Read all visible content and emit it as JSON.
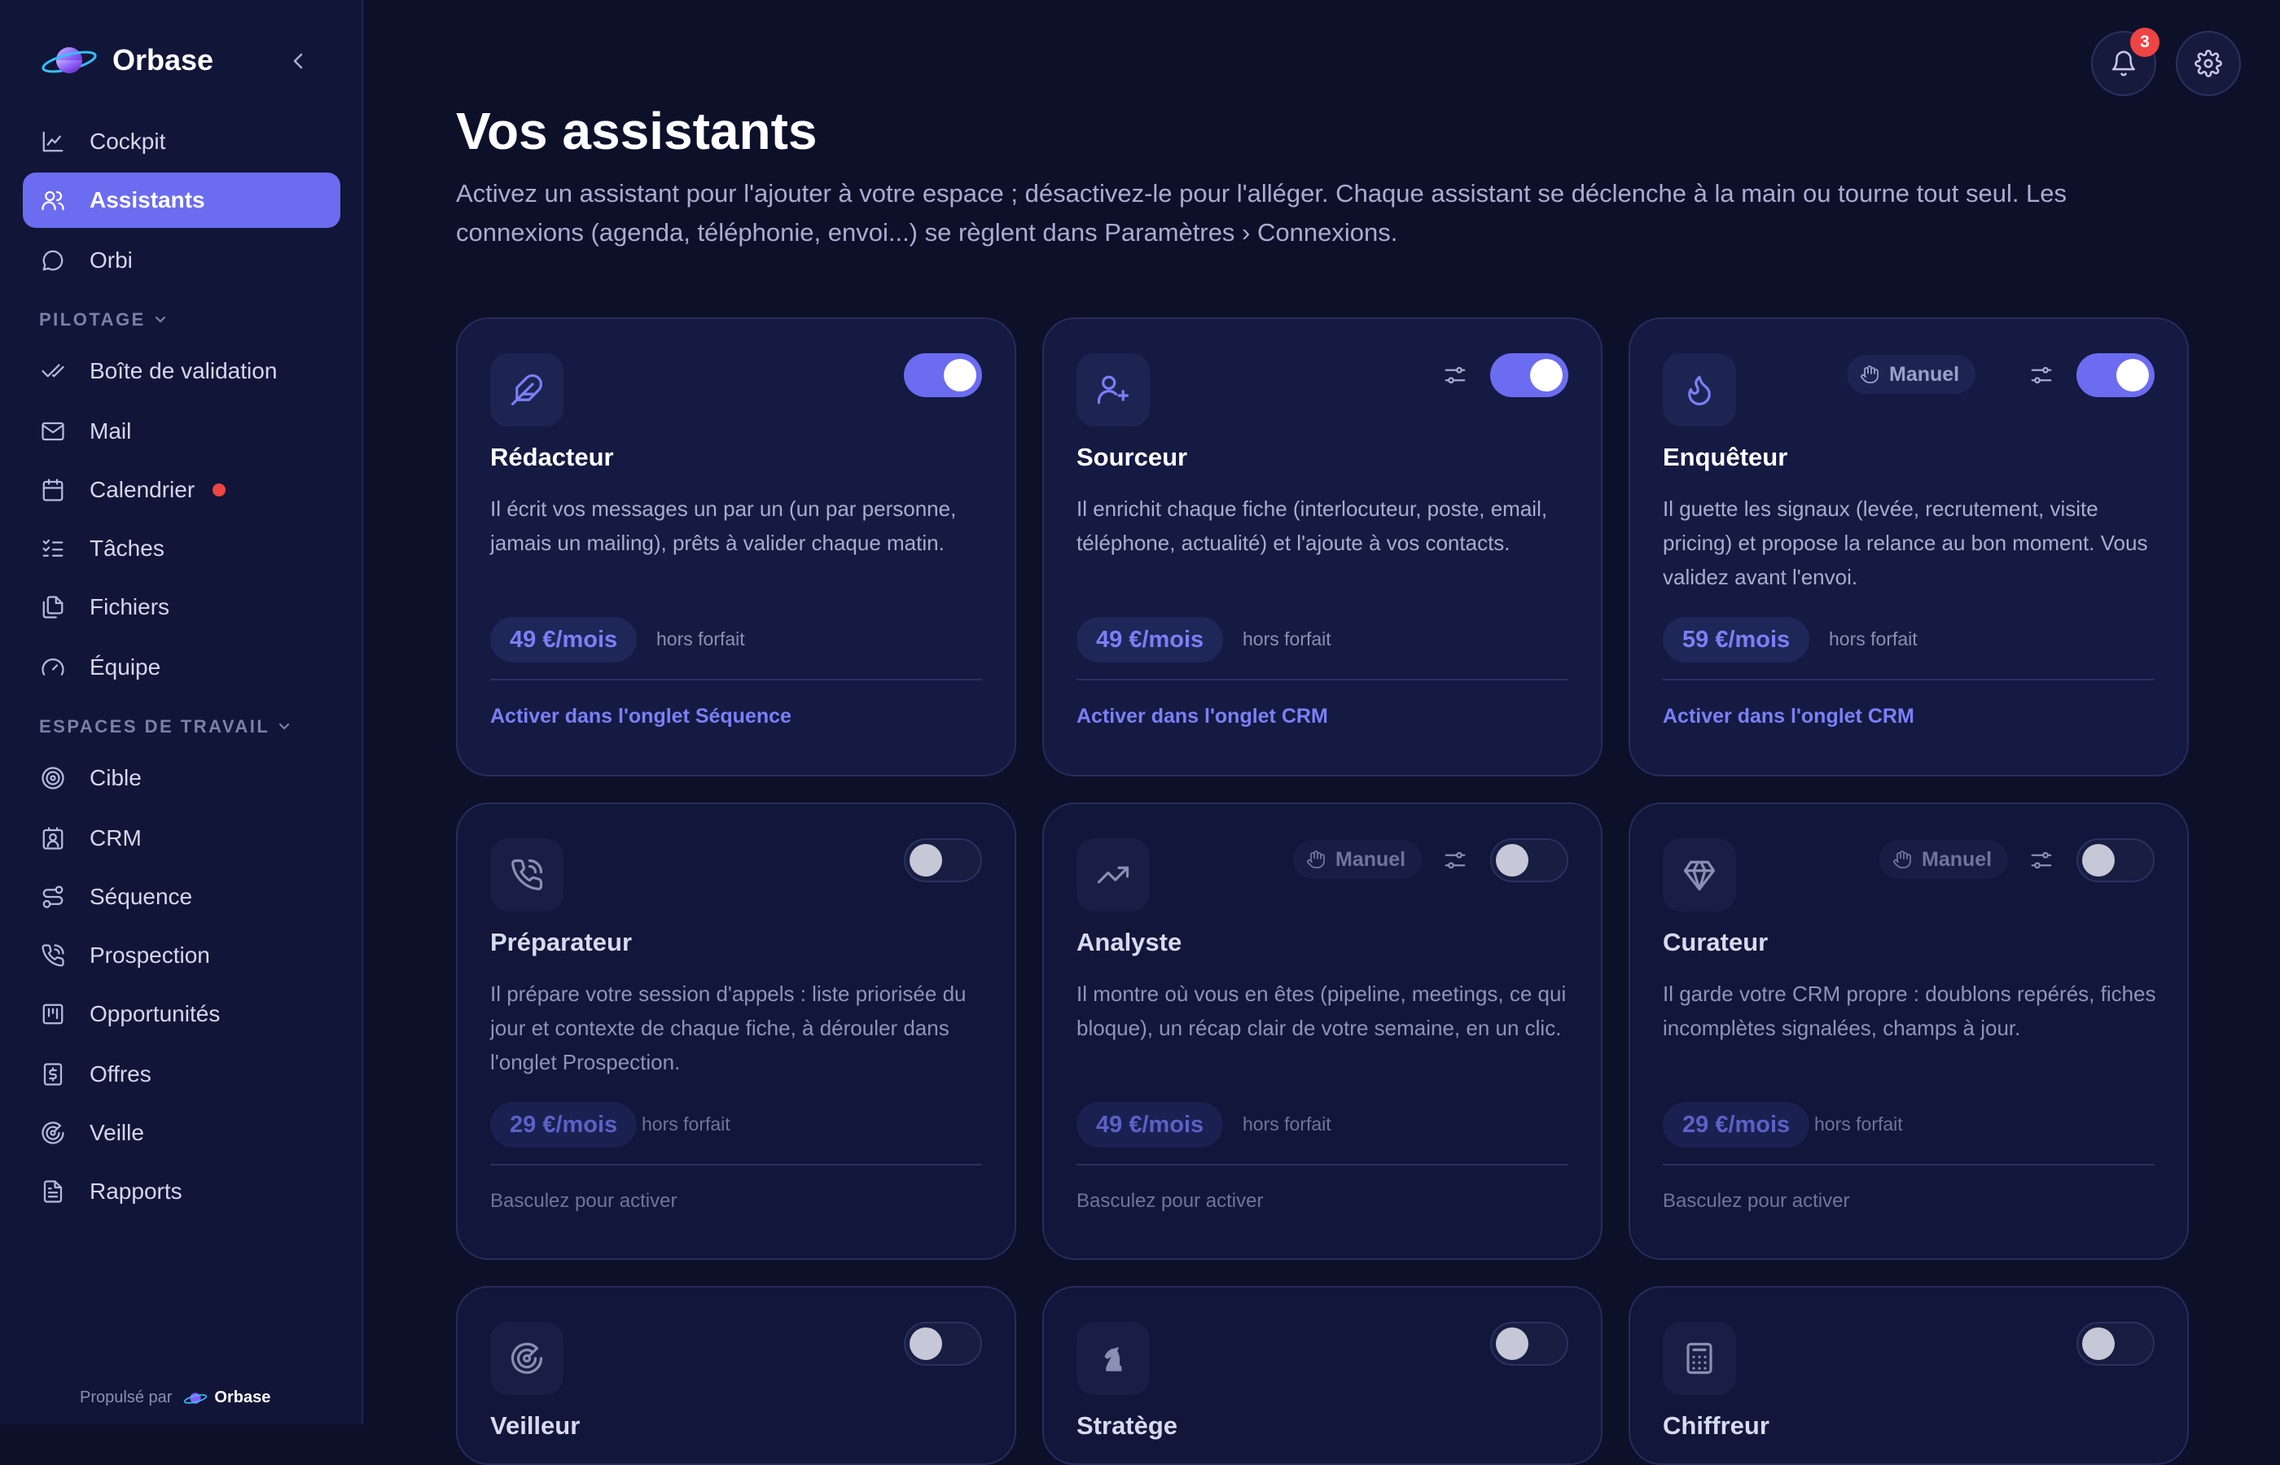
{
  "app": {
    "name": "Orbase",
    "footer_prefix": "Propulsé par",
    "footer_brand": "Orbase"
  },
  "sidebar": {
    "main": [
      {
        "label": "Cockpit"
      },
      {
        "label": "Assistants"
      },
      {
        "label": "Orbi"
      }
    ],
    "section_pilotage": "PILOTAGE",
    "pilotage": [
      {
        "label": "Boîte de validation"
      },
      {
        "label": "Mail"
      },
      {
        "label": "Calendrier"
      },
      {
        "label": "Tâches"
      },
      {
        "label": "Fichiers"
      },
      {
        "label": "Équipe"
      }
    ],
    "section_espaces": "ESPACES DE TRAVAIL",
    "espaces": [
      {
        "label": "Cible"
      },
      {
        "label": "CRM"
      },
      {
        "label": "Séquence"
      },
      {
        "label": "Prospection"
      },
      {
        "label": "Opportunités"
      },
      {
        "label": "Offres"
      },
      {
        "label": "Veille"
      },
      {
        "label": "Rapports"
      }
    ]
  },
  "header": {
    "notification_count": "3",
    "title": "Vos assistants",
    "description": "Activez un assistant pour l'ajouter à votre espace ; désactivez-le pour l'alléger. Chaque assistant se déclenche à la main ou tourne tout seul. Les connexions (agenda, téléphonie, envoi...) se règlent dans Paramètres › Connexions."
  },
  "cards": [
    {
      "icon": "feather-icon",
      "title": "Rédacteur",
      "enabled": true,
      "manual": false,
      "has_config": false,
      "description": "Il écrit vos messages un par un (un par personne, jamais un mailing), prêts à valider chaque matin.",
      "price": "49 €/mois",
      "price_note": "hors forfait",
      "action": "Activer dans l'onglet Séquence"
    },
    {
      "icon": "user-plus-icon",
      "title": "Sourceur",
      "enabled": true,
      "manual": false,
      "has_config": true,
      "description": "Il enrichit chaque fiche (interlocuteur, poste, email, téléphone, actualité) et l'ajoute à vos contacts.",
      "price": "49 €/mois",
      "price_note": "hors forfait",
      "action": "Activer dans l'onglet CRM"
    },
    {
      "icon": "flame-icon",
      "title": "Enquêteur",
      "enabled": true,
      "manual": true,
      "manual_label": "Manuel",
      "has_config": true,
      "description": "Il guette les signaux (levée, recrutement, visite pricing) et propose la relance au bon moment. Vous validez avant l'envoi.",
      "price": "59 €/mois",
      "price_note": "hors forfait",
      "action": "Activer dans l'onglet CRM"
    },
    {
      "icon": "phone-call-icon",
      "title": "Préparateur",
      "enabled": false,
      "manual": false,
      "has_config": false,
      "description": "Il prépare votre session d'appels : liste priorisée du jour et contexte de chaque fiche, à dérouler dans l'onglet Prospection.",
      "price": "29 €/mois",
      "price_note": "hors forfait",
      "hint": "Basculez pour activer"
    },
    {
      "icon": "trending-up-icon",
      "title": "Analyste",
      "enabled": false,
      "manual": true,
      "manual_label": "Manuel",
      "has_config": true,
      "description": "Il montre où vous en êtes (pipeline, meetings, ce qui bloque), un récap clair de votre semaine, en un clic.",
      "price": "49 €/mois",
      "price_note": "hors forfait",
      "hint": "Basculez pour activer"
    },
    {
      "icon": "gem-icon",
      "title": "Curateur",
      "enabled": false,
      "manual": true,
      "manual_label": "Manuel",
      "has_config": true,
      "description": "Il garde votre CRM propre : doublons repérés, fiches incomplètes signalées, champs à jour.",
      "price": "29 €/mois",
      "price_note": "hors forfait",
      "hint": "Basculez pour activer"
    },
    {
      "icon": "radar-icon",
      "title": "Veilleur",
      "enabled": false
    },
    {
      "icon": "chess-knight-icon",
      "title": "Stratège",
      "enabled": false
    },
    {
      "icon": "calculator-icon",
      "title": "Chiffreur",
      "enabled": false
    }
  ]
}
